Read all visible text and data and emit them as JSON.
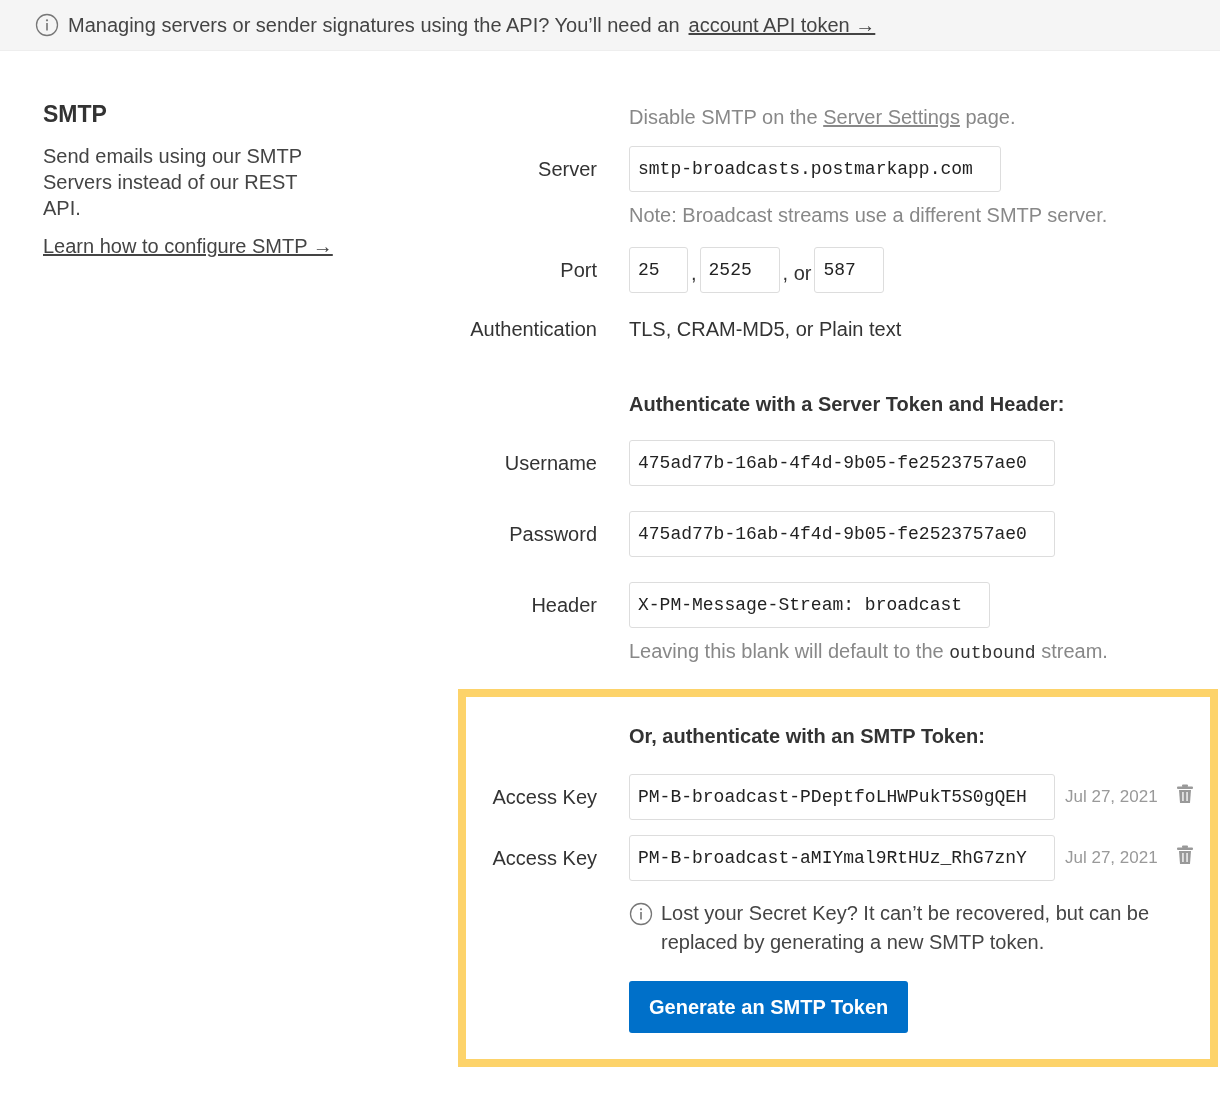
{
  "banner": {
    "text": "Managing servers or sender signatures using the API? You’ll need an",
    "link": "account API token →"
  },
  "intro": {
    "title": "SMTP",
    "description": "Send emails using our SMTP Servers instead of our REST API.",
    "link": "Learn how to configure SMTP →"
  },
  "settings_note": {
    "before": "Disable SMTP on the",
    "link": "Server Settings",
    "after": "page."
  },
  "server": {
    "label": "Server",
    "value": "smtp-broadcasts.postmarkapp.com",
    "note": "Note: Broadcast streams use a different SMTP server."
  },
  "port": {
    "label": "Port",
    "ports": [
      {
        "value": "25",
        "separator": ","
      },
      {
        "value": "2525",
        "separator": ", or"
      },
      {
        "value": "587"
      }
    ]
  },
  "authentication": {
    "label": "Authentication",
    "value": "TLS, CRAM-MD5, or Plain text"
  },
  "server_token": {
    "heading": "Authenticate with a Server Token and Header:",
    "fields": [
      {
        "label": "Username",
        "value": "475ad77b-16ab-4f4d-9b05-fe2523757ae0"
      },
      {
        "label": "Password",
        "value": "475ad77b-16ab-4f4d-9b05-fe2523757ae0"
      },
      {
        "label": "Header",
        "value": "X-PM-Message-Stream: broadcast"
      }
    ],
    "note": {
      "before": "Leaving this blank will default to the",
      "code": "outbound",
      "after": "stream."
    }
  },
  "smtp_token": {
    "heading": "Or, authenticate with an SMTP Token:",
    "keys": [
      {
        "label": "Access Key",
        "value": "PM-B-broadcast-PDeptfoLHWPukT5S0gQEH",
        "date": "Jul 27, 2021"
      },
      {
        "label": "Access Key",
        "value": "PM-B-broadcast-aMIYmal9RtHUz_RhG7znY",
        "date": "Jul 27, 2021"
      }
    ],
    "info": "Lost your Secret Key? It can’t be recovered, but can be replaced by generating a new SMTP token.",
    "button": "Generate an SMTP Token"
  }
}
